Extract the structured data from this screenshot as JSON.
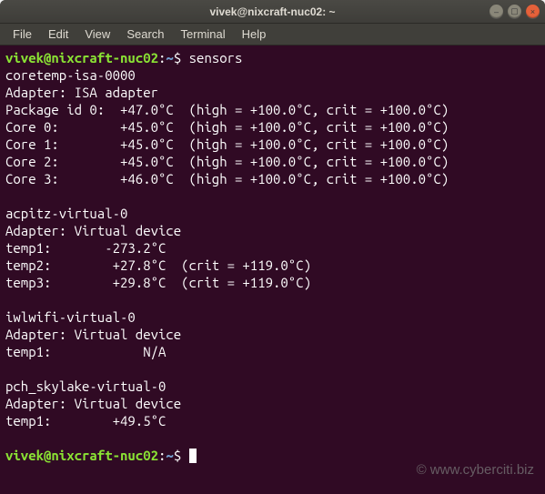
{
  "titlebar": {
    "text": "vivek@nixcraft-nuc02: ~"
  },
  "menubar": {
    "items": [
      "File",
      "Edit",
      "View",
      "Search",
      "Terminal",
      "Help"
    ]
  },
  "prompt": {
    "user_host": "vivek@nixcraft-nuc02",
    "path": "~",
    "symbol": "$"
  },
  "command": "sensors",
  "output": {
    "groups": [
      {
        "chip": "coretemp-isa-0000",
        "adapter": "Adapter: ISA adapter",
        "lines": [
          "Package id 0:  +47.0°C  (high = +100.0°C, crit = +100.0°C)",
          "Core 0:        +45.0°C  (high = +100.0°C, crit = +100.0°C)",
          "Core 1:        +45.0°C  (high = +100.0°C, crit = +100.0°C)",
          "Core 2:        +45.0°C  (high = +100.0°C, crit = +100.0°C)",
          "Core 3:        +46.0°C  (high = +100.0°C, crit = +100.0°C)"
        ]
      },
      {
        "chip": "acpitz-virtual-0",
        "adapter": "Adapter: Virtual device",
        "lines": [
          "temp1:       -273.2°C",
          "temp2:        +27.8°C  (crit = +119.0°C)",
          "temp3:        +29.8°C  (crit = +119.0°C)"
        ]
      },
      {
        "chip": "iwlwifi-virtual-0",
        "adapter": "Adapter: Virtual device",
        "lines": [
          "temp1:            N/A"
        ]
      },
      {
        "chip": "pch_skylake-virtual-0",
        "adapter": "Adapter: Virtual device",
        "lines": [
          "temp1:        +49.5°C"
        ]
      }
    ]
  },
  "watermark": "© www.cyberciti.biz",
  "window_controls": {
    "min": "–",
    "max": "▢",
    "close": "×"
  }
}
